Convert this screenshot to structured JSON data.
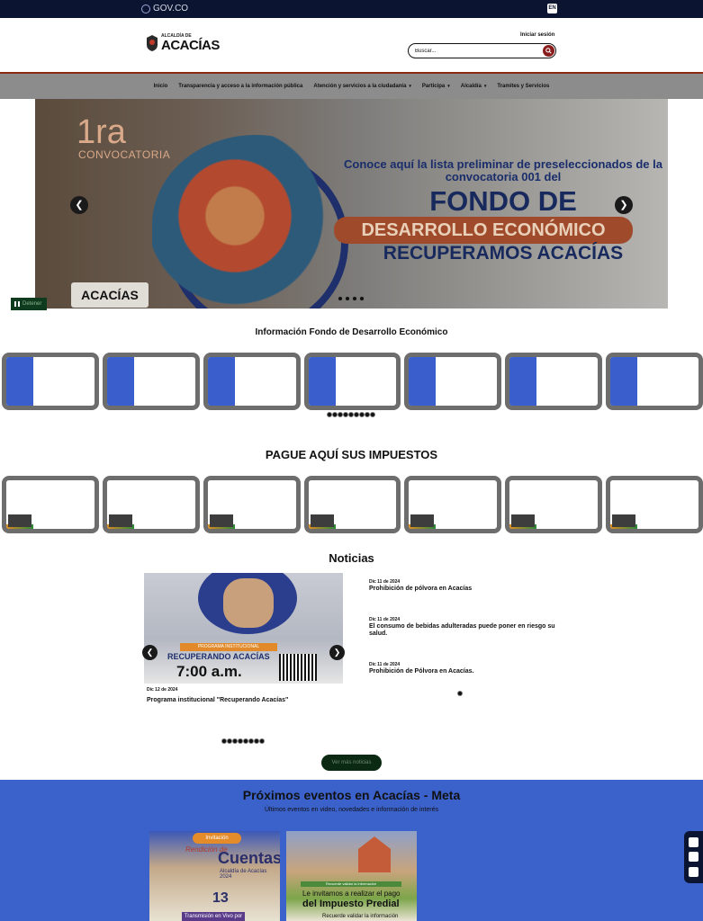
{
  "topbar": {
    "govco": "GOV.CO",
    "lang": "EN"
  },
  "header": {
    "logo_small": "ALCALDÍA DE",
    "logo_big": "ACACÍAS",
    "login": "Iniciar sesión",
    "search_placeholder": "Buscar..."
  },
  "nav": {
    "items": [
      {
        "label": "Inicio",
        "caret": false
      },
      {
        "label": "Transparencia y acceso a la información pública",
        "caret": false
      },
      {
        "label": "Atención y servicios a la ciudadanía",
        "caret": true
      },
      {
        "label": "Participa",
        "caret": true
      },
      {
        "label": "Alcaldía",
        "caret": true
      },
      {
        "label": "Tramites y Servicios",
        "caret": false
      }
    ]
  },
  "hero": {
    "big_1ra": "1ra",
    "convocatoria": "CONVOCATORIA",
    "line1": "Conoce aquí la lista preliminar de preseleccionados de la convocatoria 001 del",
    "line2": "FONDO DE",
    "line3": "DESARROLLO ECONÓMICO",
    "line4": "RECUPERAMOS ACACÍAS",
    "badge": "ACACÍAS",
    "pause_label": "Detener",
    "slide_count": 4,
    "active_slide": 1
  },
  "fondo": {
    "title": "Información Fondo de Desarrollo Económico",
    "card_count": 7,
    "dot_count": 9
  },
  "impuestos": {
    "title": "PAGUE AQUÍ SUS IMPUESTOS",
    "card_count": 7
  },
  "noticias": {
    "title": "Noticias",
    "featured": {
      "label": "PROGRAMA INSTITUCIONAL",
      "headline": "RECUPERANDO ACACÍAS",
      "time": "7:00 a.m.",
      "date": "Dic 12 de 2024",
      "title": "Programa institucional \"Recuperando Acacías\""
    },
    "side": [
      {
        "date": "Dic 11 de 2024",
        "title": "Prohibición de pólvora en Acacías"
      },
      {
        "date": "Dic 11 de 2024",
        "title": "El consumo de bebidas adulteradas puede poner en riesgo su salud."
      },
      {
        "date": "Dic 11 de 2024",
        "title": "Prohibición de Pólvora en Acacías."
      }
    ],
    "dot_count": 8,
    "more_button": "Ver más noticias"
  },
  "eventos": {
    "title": "Próximos eventos en Acacías - Meta",
    "subtitle": "Últimos eventos en video, novedades e información de interés",
    "card1": {
      "badge": "Invitación",
      "line": "Rendición de",
      "big": "Cuentas",
      "sub": "Alcaldía de Acacías 2024",
      "num": "13",
      "btn": "Transmisión en Vivo por"
    },
    "card2": {
      "bar": "Recuerde validar la información",
      "t1": "Le invitamos a realizar el pago",
      "t2": "del Impuesto Predial",
      "t3": "Recuerde validar la información"
    }
  }
}
